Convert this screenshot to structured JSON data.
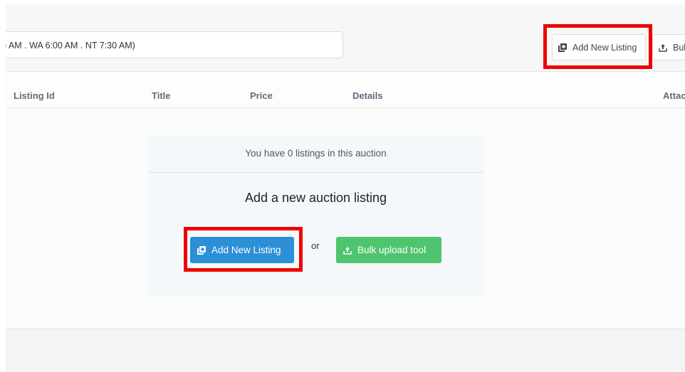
{
  "toolbar": {
    "timezone_text": ") AM . WA 6:00 AM . NT 7:30 AM)",
    "add_listing_label": "Add New Listing",
    "bulk_label": "Bul"
  },
  "table": {
    "columns": [
      "Listing Id",
      "Title",
      "Price",
      "Details",
      "Attac"
    ]
  },
  "empty_state": {
    "message": "You have 0 listings in this auction",
    "heading": "Add a new auction listing",
    "add_button_label": "Add New Listing",
    "or_label": "or",
    "bulk_button_label": "Bulk upload tool"
  },
  "icons": {
    "add_listing": "add-listing-icon",
    "bulk_upload": "upload-icon"
  },
  "colors": {
    "primary": "#2d8fd6",
    "success": "#4fc46e",
    "highlight": "#ee0000"
  }
}
